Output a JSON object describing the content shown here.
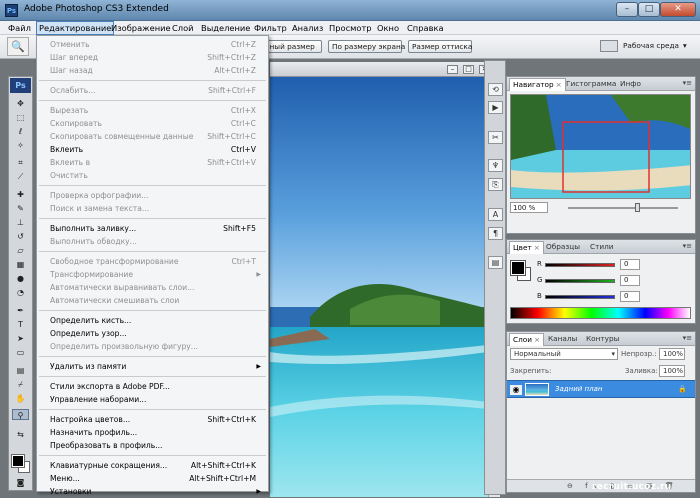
{
  "window": {
    "title": "Adobe Photoshop CS3 Extended",
    "app_icon": "Ps",
    "min": "–",
    "max": "□",
    "close": "✕"
  },
  "menubar": [
    "Файл",
    "Редактирование",
    "Изображение",
    "Слой",
    "Выделение",
    "Фильтр",
    "Анализ",
    "Просмотр",
    "Окно",
    "Справка"
  ],
  "options": {
    "btn1": "ьный размер",
    "btn2": "По размеру экрана",
    "btn3": "Размер оттиска",
    "workspace": "Рабочая среда"
  },
  "toolbox": {
    "logo": "Ps"
  },
  "edit_menu": [
    {
      "label": "Отменить",
      "shortcut": "Ctrl+Z",
      "enabled": false
    },
    {
      "label": "Шаг вперед",
      "shortcut": "Shift+Ctrl+Z",
      "enabled": false
    },
    {
      "label": "Шаг назад",
      "shortcut": "Alt+Ctrl+Z",
      "enabled": false
    },
    {
      "sep": true
    },
    {
      "label": "Ослабить...",
      "shortcut": "Shift+Ctrl+F",
      "enabled": false
    },
    {
      "sep": true
    },
    {
      "label": "Вырезать",
      "shortcut": "Ctrl+X",
      "enabled": false
    },
    {
      "label": "Скопировать",
      "shortcut": "Ctrl+C",
      "enabled": false
    },
    {
      "label": "Скопировать совмещенные данные",
      "shortcut": "Shift+Ctrl+C",
      "enabled": false
    },
    {
      "label": "Вклеить",
      "shortcut": "Ctrl+V",
      "enabled": true
    },
    {
      "label": "Вклеить в",
      "shortcut": "Shift+Ctrl+V",
      "enabled": false
    },
    {
      "label": "Очистить",
      "shortcut": "",
      "enabled": false
    },
    {
      "sep": true
    },
    {
      "label": "Проверка орфографии...",
      "shortcut": "",
      "enabled": false
    },
    {
      "label": "Поиск и замена текста...",
      "shortcut": "",
      "enabled": false
    },
    {
      "sep": true
    },
    {
      "label": "Выполнить заливку...",
      "shortcut": "Shift+F5",
      "enabled": true
    },
    {
      "label": "Выполнить обводку...",
      "shortcut": "",
      "enabled": false
    },
    {
      "sep": true
    },
    {
      "label": "Свободное трансформирование",
      "shortcut": "Ctrl+T",
      "enabled": false
    },
    {
      "label": "Трансформирование",
      "shortcut": "",
      "enabled": false,
      "submenu": true
    },
    {
      "label": "Автоматически выравнивать слои...",
      "shortcut": "",
      "enabled": false
    },
    {
      "label": "Автоматически смешивать слои",
      "shortcut": "",
      "enabled": false
    },
    {
      "sep": true
    },
    {
      "label": "Определить кисть...",
      "shortcut": "",
      "enabled": true
    },
    {
      "label": "Определить узор...",
      "shortcut": "",
      "enabled": true
    },
    {
      "label": "Определить произвольную фигуру...",
      "shortcut": "",
      "enabled": false
    },
    {
      "sep": true
    },
    {
      "label": "Удалить из памяти",
      "shortcut": "",
      "enabled": true,
      "submenu": true
    },
    {
      "sep": true
    },
    {
      "label": "Стили экспорта в Adobe PDF...",
      "shortcut": "",
      "enabled": true
    },
    {
      "label": "Управление наборами...",
      "shortcut": "",
      "enabled": true
    },
    {
      "sep": true
    },
    {
      "label": "Настройка цветов...",
      "shortcut": "Shift+Ctrl+K",
      "enabled": true
    },
    {
      "label": "Назначить профиль...",
      "shortcut": "",
      "enabled": true
    },
    {
      "label": "Преобразовать в профиль...",
      "shortcut": "",
      "enabled": true
    },
    {
      "sep": true
    },
    {
      "label": "Клавиатурные сокращения...",
      "shortcut": "Alt+Shift+Ctrl+K",
      "enabled": true
    },
    {
      "label": "Меню...",
      "shortcut": "Alt+Shift+Ctrl+M",
      "enabled": true
    },
    {
      "label": "Установки",
      "shortcut": "",
      "enabled": true,
      "submenu": true
    }
  ],
  "navigator": {
    "tabs": [
      "Навигатор",
      "Гистограмма",
      "Инфо"
    ],
    "zoom": "100 %"
  },
  "color_panel": {
    "tabs": [
      "Цвет",
      "Образцы",
      "Стили"
    ],
    "channels": [
      {
        "label": "R",
        "value": "0",
        "color": "#e02020"
      },
      {
        "label": "G",
        "value": "0",
        "color": "#20b020"
      },
      {
        "label": "B",
        "value": "0",
        "color": "#2030e0"
      }
    ]
  },
  "layers_panel": {
    "tabs": [
      "Слои",
      "Каналы",
      "Контуры"
    ],
    "blend_mode": "Нормальный",
    "opacity_label": "Непрозр.:",
    "opacity": "100%",
    "lock_label": "Закрепить:",
    "fill_label": "Заливка:",
    "fill": "100%",
    "layer_name": "Задний план",
    "footer_icons": "⊖ fx ◐ ▭ ▤ 🗑"
  },
  "watermark": "recruit.ucoz.ru",
  "colors": {
    "accent": "#3b8be0",
    "menu_bg": "#f4f5f7",
    "title_bar": "#6f93b8"
  }
}
